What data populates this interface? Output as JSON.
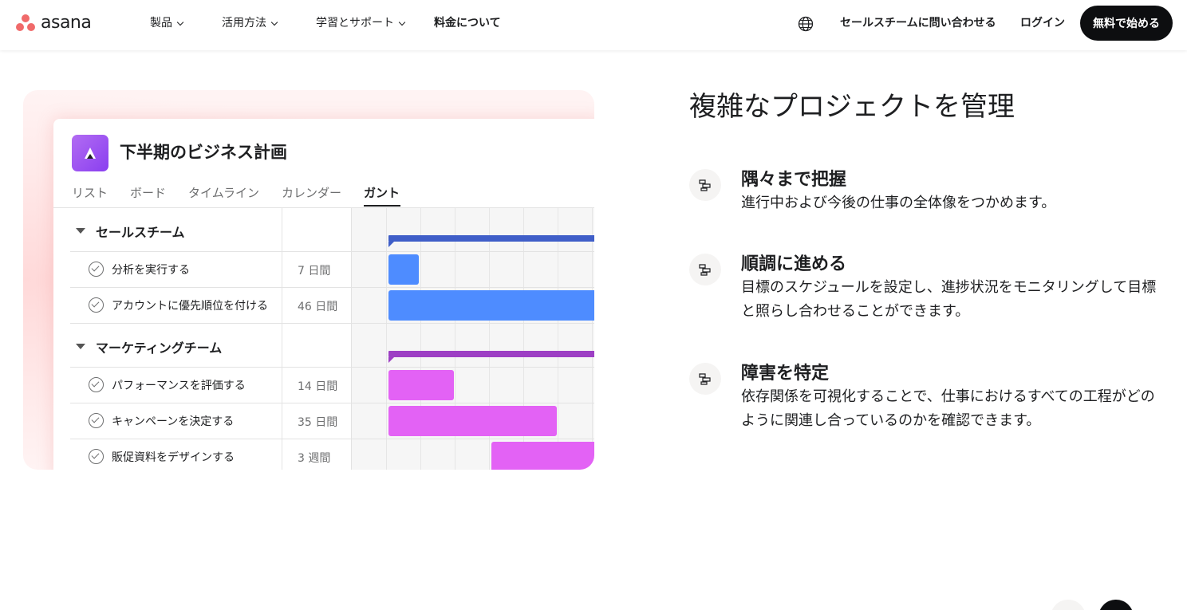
{
  "header": {
    "logo_text": "asana",
    "nav": [
      {
        "label": "製品"
      },
      {
        "label": "活用方法"
      },
      {
        "label": "学習とサポート"
      },
      {
        "label": "料金について"
      }
    ],
    "contact_label": "セールスチームに問い合わせる",
    "login_label": "ログイン",
    "signup_label": "無料で始める"
  },
  "illustration": {
    "project_title": "下半期のビジネス計画",
    "tabs": [
      "リスト",
      "ボード",
      "タイムライン",
      "カレンダー",
      "ガント"
    ],
    "active_tab": "ガント",
    "sections": [
      {
        "name": "セールスチーム",
        "color": "#3f5ec8",
        "tasks": [
          {
            "name": "分析を実行する",
            "duration": "7 日間",
            "color": "#4e8cff"
          },
          {
            "name": "アカウントに優先順位を付ける",
            "duration": "46 日間",
            "color": "#4e8cff"
          }
        ]
      },
      {
        "name": "マーケティングチーム",
        "color": "#9d3fc4",
        "tasks": [
          {
            "name": "パフォーマンスを評価する",
            "duration": "14 日間",
            "color": "#e362f5"
          },
          {
            "name": "キャンペーンを決定する",
            "duration": "35 日間",
            "color": "#e362f5"
          },
          {
            "name": "販促資料をデザインする",
            "duration": "3 週間",
            "color": "#e362f5"
          }
        ]
      }
    ]
  },
  "content": {
    "headline": "複雑なプロジェクトを管理",
    "features": [
      {
        "title": "隅々まで把握",
        "description": "進行中および今後の仕事の全体像をつかめます。"
      },
      {
        "title": "順調に進める",
        "description": "目標のスケジュールを設定し、進捗状況をモニタリングして目標と照らし合わせることができます。"
      },
      {
        "title": "障害を特定",
        "description": "依存関係を可視化することで、仕事におけるすべての工程がどのように関連し合っているのかを確認できます。"
      }
    ]
  }
}
